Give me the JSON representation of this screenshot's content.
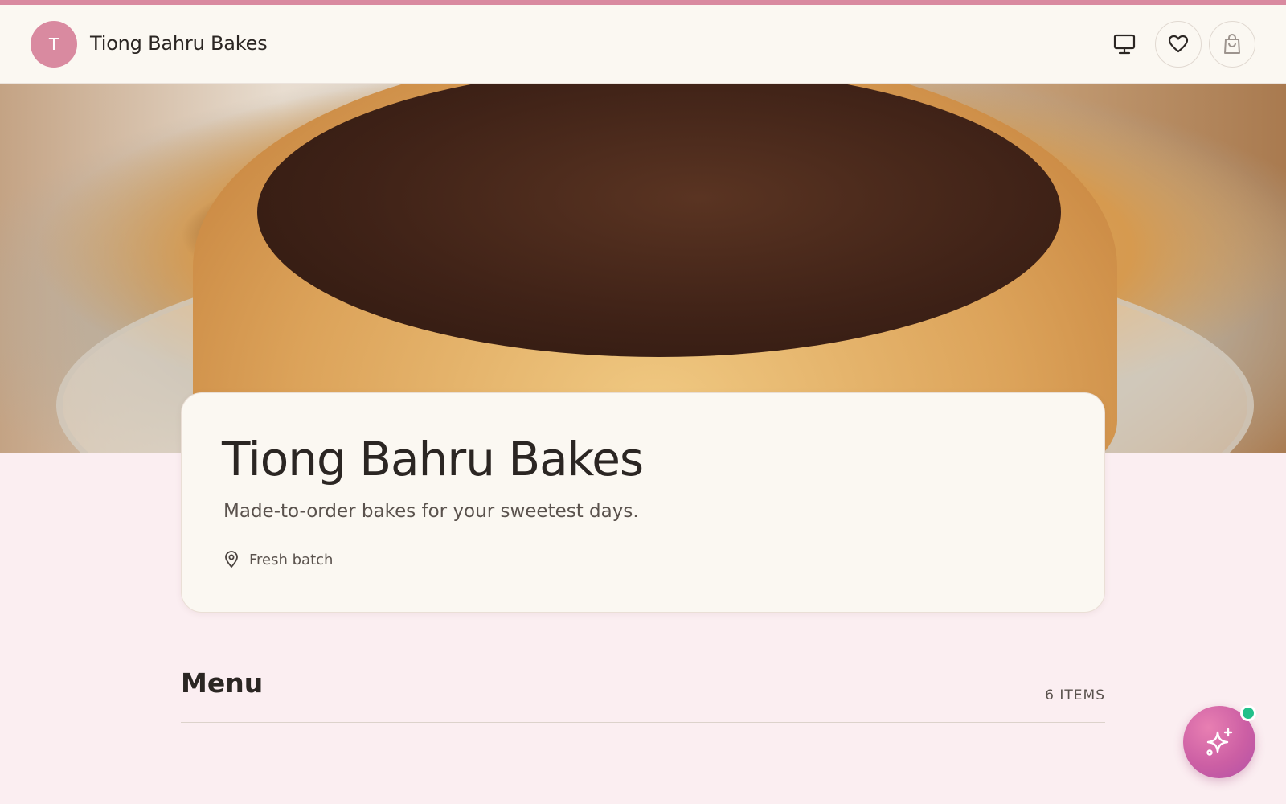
{
  "header": {
    "avatar_initial": "T",
    "brand_name": "Tiong Bahru Bakes",
    "icons": [
      "monitor-icon",
      "heart-icon",
      "shopping-bag-icon"
    ]
  },
  "hero": {
    "image_description_icon": "hero-image"
  },
  "card": {
    "title": "Tiong Bahru Bakes",
    "subtitle": "Made-to-order bakes for your sweetest days.",
    "meta_label": "Fresh batch",
    "meta_icon": "location-pin-icon"
  },
  "menu": {
    "title": "Menu",
    "item_count_label": "6 ITEMS"
  },
  "fab": {
    "icon": "sparkles-icon",
    "status_color": "#22c08a"
  },
  "colors": {
    "accent": "#d98aa0",
    "background": "#fbeef1",
    "surface": "#fbf8f2",
    "fab_gradient_start": "#e87fb2",
    "fab_gradient_end": "#b250a6"
  }
}
